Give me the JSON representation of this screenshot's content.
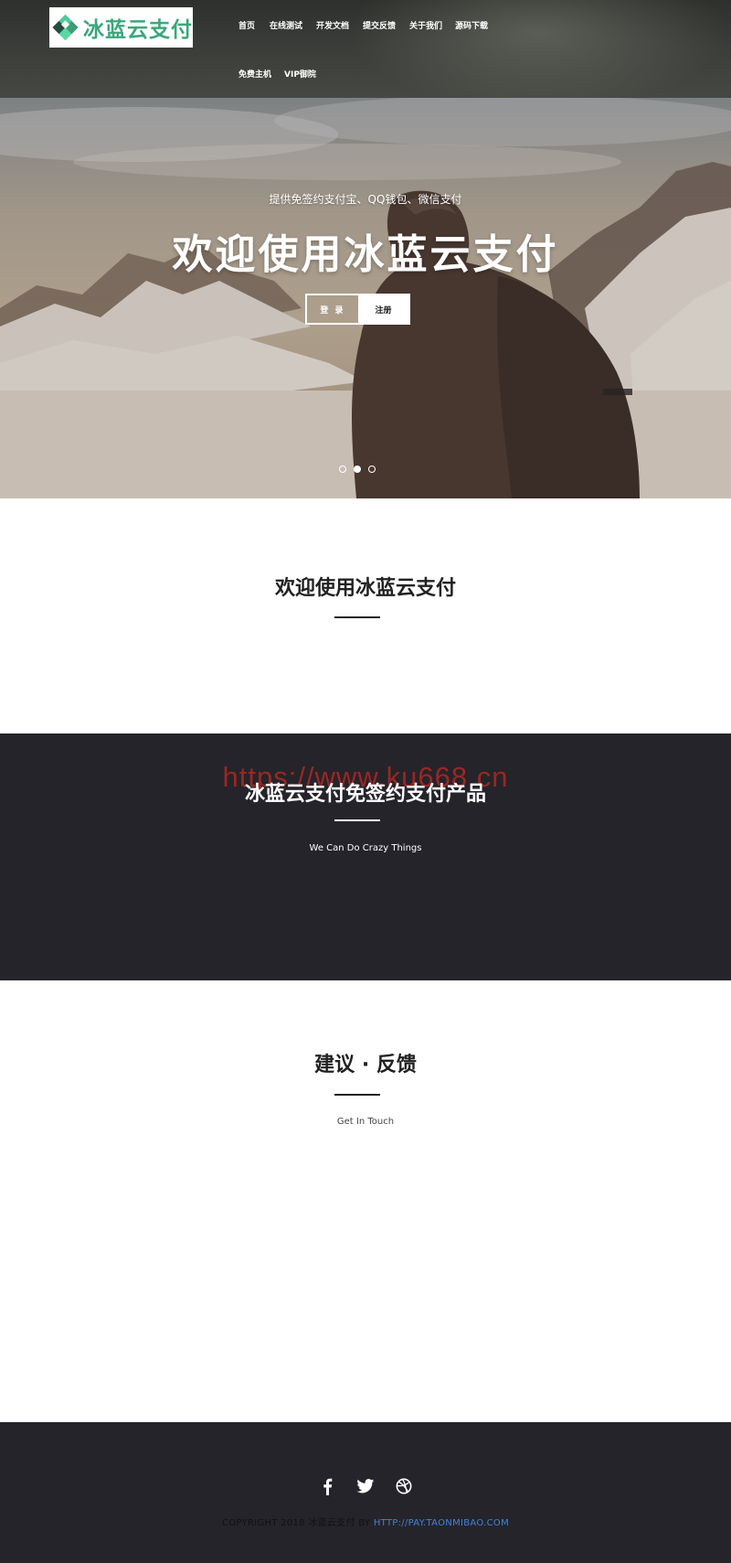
{
  "brand": {
    "logo_text": "冰蓝云支付"
  },
  "nav": {
    "items": [
      {
        "label": "首页"
      },
      {
        "label": "在线测试"
      },
      {
        "label": "开发文档"
      },
      {
        "label": "提交反馈"
      },
      {
        "label": "关于我们"
      },
      {
        "label": "源码下载"
      },
      {
        "label": "免费主机"
      },
      {
        "label": "VIP御院"
      }
    ]
  },
  "hero": {
    "subtitle": "提供免签约支付宝、QQ钱包、微信支付",
    "title_prefix": "欢迎使用",
    "title_bold": "冰蓝云支付",
    "login_label": "登 录",
    "register_label": "注册",
    "slides": {
      "count": 3,
      "active_index": 1
    }
  },
  "welcome": {
    "title_prefix": "欢迎使用",
    "title_bold": "冰蓝云支付"
  },
  "products": {
    "watermark": "https://www.ku668.cn",
    "title": "冰蓝云支付免签约支付产品",
    "subtitle": "We Can Do Crazy Things"
  },
  "feedback": {
    "title": "建议 · 反馈",
    "subtitle": "Get In Touch"
  },
  "footer": {
    "social": [
      "facebook-icon",
      "twitter-icon",
      "dribbble-icon"
    ],
    "copyright_text": "COPYRIGHT 2018 冰蓝云支付 BY ",
    "copyright_link": "HTTP://PAY.TAONMIBAO.COM"
  },
  "colors": {
    "dark_section": "#25242b",
    "logo_green": "#3aa77a",
    "link_blue": "#3f84d6",
    "watermark_red": "#c8281e"
  }
}
